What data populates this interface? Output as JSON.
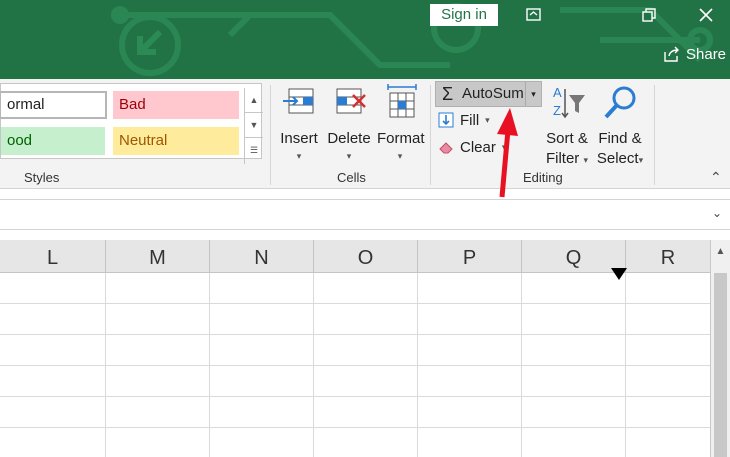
{
  "titlebar": {
    "sign_in": "Sign in",
    "share": "Share"
  },
  "styles": {
    "normal": "ormal",
    "bad": "Bad",
    "good": "ood",
    "neutral": "Neutral",
    "group_label": "Styles"
  },
  "cells_group": {
    "insert": "Insert",
    "delete": "Delete",
    "format": "Format",
    "group_label": "Cells"
  },
  "editing": {
    "autosum": "AutoSum",
    "fill": "Fill",
    "clear": "Clear",
    "sort_line1": "Sort &",
    "sort_line2": "Filter",
    "find_line1": "Find &",
    "find_line2": "Select",
    "group_label": "Editing"
  },
  "columns": [
    "L",
    "M",
    "N",
    "O",
    "P",
    "Q",
    "R"
  ],
  "colors": {
    "brand": "#217346",
    "arrow": "#e81123"
  }
}
